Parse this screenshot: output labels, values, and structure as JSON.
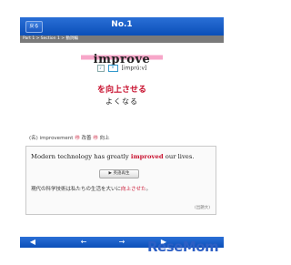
{
  "header": {
    "back_label": "戻る",
    "title": "No.1"
  },
  "breadcrumb": "Part 1 > Section 1 > 動詞編",
  "entry": {
    "word": "improve",
    "speaker_icon": "speaker-icon",
    "pos": "V",
    "pronunciation": "[imprúːv]",
    "meaning": "を向上させる",
    "reading": "よくなる",
    "derivatives": {
      "noun_label": "(名)",
      "noun": "improvement",
      "mark1": "㊞",
      "kanji1": "改善",
      "mark2": "㊞",
      "kanji2": "向上"
    }
  },
  "example": {
    "en_before": "Modern technology has greatly ",
    "en_highlight": "improved",
    "en_after": " our lives.",
    "play_label": "▶ 英語再生",
    "ja_before": "現代の科学技術は私たちの生活を大いに",
    "ja_highlight": "向上させた",
    "ja_after": "。",
    "source": "(出題大)"
  },
  "footer": {
    "left": "◀",
    "prev": "←",
    "next": "→",
    "right": "▶"
  },
  "watermark": "ReseMom"
}
